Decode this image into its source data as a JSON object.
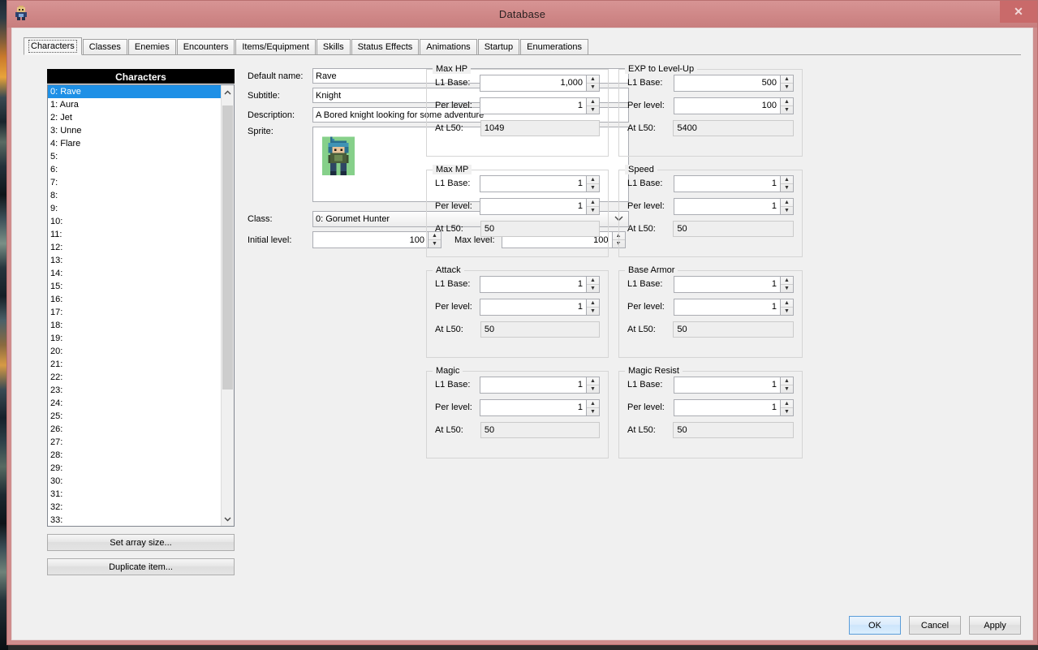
{
  "window": {
    "title": "Database",
    "close_label": "✕",
    "app_icon": "character-sprite-icon"
  },
  "tabs": [
    {
      "label": "Characters",
      "active": true
    },
    {
      "label": "Classes",
      "active": false
    },
    {
      "label": "Enemies",
      "active": false
    },
    {
      "label": "Encounters",
      "active": false
    },
    {
      "label": "Items/Equipment",
      "active": false
    },
    {
      "label": "Skills",
      "active": false
    },
    {
      "label": "Status Effects",
      "active": false
    },
    {
      "label": "Animations",
      "active": false
    },
    {
      "label": "Startup",
      "active": false
    },
    {
      "label": "Enumerations",
      "active": false
    }
  ],
  "list_panel": {
    "header": "Characters",
    "items": [
      {
        "label": "0: Rave",
        "selected": true
      },
      {
        "label": "1: Aura",
        "selected": false
      },
      {
        "label": "2: Jet",
        "selected": false
      },
      {
        "label": "3: Unne",
        "selected": false
      },
      {
        "label": "4: Flare",
        "selected": false
      },
      {
        "label": "5:",
        "selected": false
      },
      {
        "label": "6:",
        "selected": false
      },
      {
        "label": "7:",
        "selected": false
      },
      {
        "label": "8:",
        "selected": false
      },
      {
        "label": "9:",
        "selected": false
      },
      {
        "label": "10:",
        "selected": false
      },
      {
        "label": "11:",
        "selected": false
      },
      {
        "label": "12:",
        "selected": false
      },
      {
        "label": "13:",
        "selected": false
      },
      {
        "label": "14:",
        "selected": false
      },
      {
        "label": "15:",
        "selected": false
      },
      {
        "label": "16:",
        "selected": false
      },
      {
        "label": "17:",
        "selected": false
      },
      {
        "label": "18:",
        "selected": false
      },
      {
        "label": "19:",
        "selected": false
      },
      {
        "label": "20:",
        "selected": false
      },
      {
        "label": "21:",
        "selected": false
      },
      {
        "label": "22:",
        "selected": false
      },
      {
        "label": "23:",
        "selected": false
      },
      {
        "label": "24:",
        "selected": false
      },
      {
        "label": "25:",
        "selected": false
      },
      {
        "label": "26:",
        "selected": false
      },
      {
        "label": "27:",
        "selected": false
      },
      {
        "label": "28:",
        "selected": false
      },
      {
        "label": "29:",
        "selected": false
      },
      {
        "label": "30:",
        "selected": false
      },
      {
        "label": "31:",
        "selected": false
      },
      {
        "label": "32:",
        "selected": false
      },
      {
        "label": "33:",
        "selected": false
      }
    ],
    "scroll_up_icon": "chevron-up-icon",
    "scroll_down_icon": "chevron-down-icon",
    "set_array_size_label": "Set array size...",
    "duplicate_item_label": "Duplicate item..."
  },
  "form": {
    "default_name_label": "Default name:",
    "default_name_value": "Rave",
    "subtitle_label": "Subtitle:",
    "subtitle_value": "Knight",
    "description_label": "Description:",
    "description_value": "A Bored knight looking for some adventure",
    "sprite_label": "Sprite:",
    "sprite_alt": "character-sprite",
    "class_label": "Class:",
    "class_value": "0: Gorumet Hunter",
    "class_caret_icon": "chevron-down-icon",
    "initial_level_label": "Initial level:",
    "initial_level_value": "100",
    "max_level_label": "Max level:",
    "max_level_value": "100",
    "spin_up_icon": "spinner-up-icon",
    "spin_down_icon": "spinner-down-icon"
  },
  "stat_labels": {
    "l1_base": "L1 Base:",
    "per_level": "Per level:",
    "at_l50": "At L50:"
  },
  "stat_groups": [
    {
      "title": "Max HP",
      "l1_base": "1,000",
      "per_level": "1",
      "at_l50": "1049"
    },
    {
      "title": "EXP to Level-Up",
      "l1_base": "500",
      "per_level": "100",
      "at_l50": "5400"
    },
    {
      "title": "Max MP",
      "l1_base": "1",
      "per_level": "1",
      "at_l50": "50"
    },
    {
      "title": "Speed",
      "l1_base": "1",
      "per_level": "1",
      "at_l50": "50"
    },
    {
      "title": "Attack",
      "l1_base": "1",
      "per_level": "1",
      "at_l50": "50"
    },
    {
      "title": "Base Armor",
      "l1_base": "1",
      "per_level": "1",
      "at_l50": "50"
    },
    {
      "title": "Magic",
      "l1_base": "1",
      "per_level": "1",
      "at_l50": "50"
    },
    {
      "title": "Magic Resist",
      "l1_base": "1",
      "per_level": "1",
      "at_l50": "50"
    }
  ],
  "footer": {
    "ok_label": "OK",
    "cancel_label": "Cancel",
    "apply_label": "Apply"
  },
  "colors": {
    "titlebar": "#cf8787",
    "selection": "#1e90e6",
    "list_header_bg": "#000000",
    "client_bg": "#f0f0f0"
  }
}
